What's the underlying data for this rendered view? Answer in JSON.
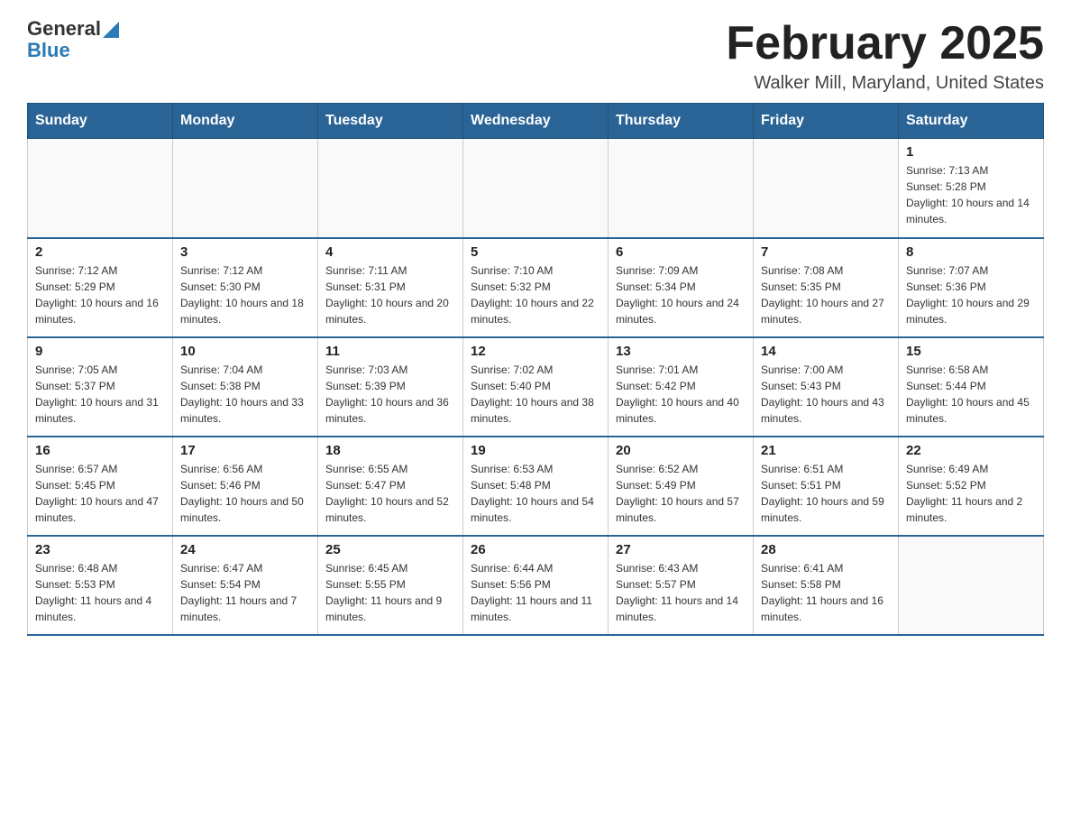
{
  "header": {
    "logo_general": "General",
    "logo_blue": "Blue",
    "month_title": "February 2025",
    "location": "Walker Mill, Maryland, United States"
  },
  "days_of_week": [
    "Sunday",
    "Monday",
    "Tuesday",
    "Wednesday",
    "Thursday",
    "Friday",
    "Saturday"
  ],
  "weeks": [
    [
      {
        "num": "",
        "sunrise": "",
        "sunset": "",
        "daylight": ""
      },
      {
        "num": "",
        "sunrise": "",
        "sunset": "",
        "daylight": ""
      },
      {
        "num": "",
        "sunrise": "",
        "sunset": "",
        "daylight": ""
      },
      {
        "num": "",
        "sunrise": "",
        "sunset": "",
        "daylight": ""
      },
      {
        "num": "",
        "sunrise": "",
        "sunset": "",
        "daylight": ""
      },
      {
        "num": "",
        "sunrise": "",
        "sunset": "",
        "daylight": ""
      },
      {
        "num": "1",
        "sunrise": "Sunrise: 7:13 AM",
        "sunset": "Sunset: 5:28 PM",
        "daylight": "Daylight: 10 hours and 14 minutes."
      }
    ],
    [
      {
        "num": "2",
        "sunrise": "Sunrise: 7:12 AM",
        "sunset": "Sunset: 5:29 PM",
        "daylight": "Daylight: 10 hours and 16 minutes."
      },
      {
        "num": "3",
        "sunrise": "Sunrise: 7:12 AM",
        "sunset": "Sunset: 5:30 PM",
        "daylight": "Daylight: 10 hours and 18 minutes."
      },
      {
        "num": "4",
        "sunrise": "Sunrise: 7:11 AM",
        "sunset": "Sunset: 5:31 PM",
        "daylight": "Daylight: 10 hours and 20 minutes."
      },
      {
        "num": "5",
        "sunrise": "Sunrise: 7:10 AM",
        "sunset": "Sunset: 5:32 PM",
        "daylight": "Daylight: 10 hours and 22 minutes."
      },
      {
        "num": "6",
        "sunrise": "Sunrise: 7:09 AM",
        "sunset": "Sunset: 5:34 PM",
        "daylight": "Daylight: 10 hours and 24 minutes."
      },
      {
        "num": "7",
        "sunrise": "Sunrise: 7:08 AM",
        "sunset": "Sunset: 5:35 PM",
        "daylight": "Daylight: 10 hours and 27 minutes."
      },
      {
        "num": "8",
        "sunrise": "Sunrise: 7:07 AM",
        "sunset": "Sunset: 5:36 PM",
        "daylight": "Daylight: 10 hours and 29 minutes."
      }
    ],
    [
      {
        "num": "9",
        "sunrise": "Sunrise: 7:05 AM",
        "sunset": "Sunset: 5:37 PM",
        "daylight": "Daylight: 10 hours and 31 minutes."
      },
      {
        "num": "10",
        "sunrise": "Sunrise: 7:04 AM",
        "sunset": "Sunset: 5:38 PM",
        "daylight": "Daylight: 10 hours and 33 minutes."
      },
      {
        "num": "11",
        "sunrise": "Sunrise: 7:03 AM",
        "sunset": "Sunset: 5:39 PM",
        "daylight": "Daylight: 10 hours and 36 minutes."
      },
      {
        "num": "12",
        "sunrise": "Sunrise: 7:02 AM",
        "sunset": "Sunset: 5:40 PM",
        "daylight": "Daylight: 10 hours and 38 minutes."
      },
      {
        "num": "13",
        "sunrise": "Sunrise: 7:01 AM",
        "sunset": "Sunset: 5:42 PM",
        "daylight": "Daylight: 10 hours and 40 minutes."
      },
      {
        "num": "14",
        "sunrise": "Sunrise: 7:00 AM",
        "sunset": "Sunset: 5:43 PM",
        "daylight": "Daylight: 10 hours and 43 minutes."
      },
      {
        "num": "15",
        "sunrise": "Sunrise: 6:58 AM",
        "sunset": "Sunset: 5:44 PM",
        "daylight": "Daylight: 10 hours and 45 minutes."
      }
    ],
    [
      {
        "num": "16",
        "sunrise": "Sunrise: 6:57 AM",
        "sunset": "Sunset: 5:45 PM",
        "daylight": "Daylight: 10 hours and 47 minutes."
      },
      {
        "num": "17",
        "sunrise": "Sunrise: 6:56 AM",
        "sunset": "Sunset: 5:46 PM",
        "daylight": "Daylight: 10 hours and 50 minutes."
      },
      {
        "num": "18",
        "sunrise": "Sunrise: 6:55 AM",
        "sunset": "Sunset: 5:47 PM",
        "daylight": "Daylight: 10 hours and 52 minutes."
      },
      {
        "num": "19",
        "sunrise": "Sunrise: 6:53 AM",
        "sunset": "Sunset: 5:48 PM",
        "daylight": "Daylight: 10 hours and 54 minutes."
      },
      {
        "num": "20",
        "sunrise": "Sunrise: 6:52 AM",
        "sunset": "Sunset: 5:49 PM",
        "daylight": "Daylight: 10 hours and 57 minutes."
      },
      {
        "num": "21",
        "sunrise": "Sunrise: 6:51 AM",
        "sunset": "Sunset: 5:51 PM",
        "daylight": "Daylight: 10 hours and 59 minutes."
      },
      {
        "num": "22",
        "sunrise": "Sunrise: 6:49 AM",
        "sunset": "Sunset: 5:52 PM",
        "daylight": "Daylight: 11 hours and 2 minutes."
      }
    ],
    [
      {
        "num": "23",
        "sunrise": "Sunrise: 6:48 AM",
        "sunset": "Sunset: 5:53 PM",
        "daylight": "Daylight: 11 hours and 4 minutes."
      },
      {
        "num": "24",
        "sunrise": "Sunrise: 6:47 AM",
        "sunset": "Sunset: 5:54 PM",
        "daylight": "Daylight: 11 hours and 7 minutes."
      },
      {
        "num": "25",
        "sunrise": "Sunrise: 6:45 AM",
        "sunset": "Sunset: 5:55 PM",
        "daylight": "Daylight: 11 hours and 9 minutes."
      },
      {
        "num": "26",
        "sunrise": "Sunrise: 6:44 AM",
        "sunset": "Sunset: 5:56 PM",
        "daylight": "Daylight: 11 hours and 11 minutes."
      },
      {
        "num": "27",
        "sunrise": "Sunrise: 6:43 AM",
        "sunset": "Sunset: 5:57 PM",
        "daylight": "Daylight: 11 hours and 14 minutes."
      },
      {
        "num": "28",
        "sunrise": "Sunrise: 6:41 AM",
        "sunset": "Sunset: 5:58 PM",
        "daylight": "Daylight: 11 hours and 16 minutes."
      },
      {
        "num": "",
        "sunrise": "",
        "sunset": "",
        "daylight": ""
      }
    ]
  ]
}
